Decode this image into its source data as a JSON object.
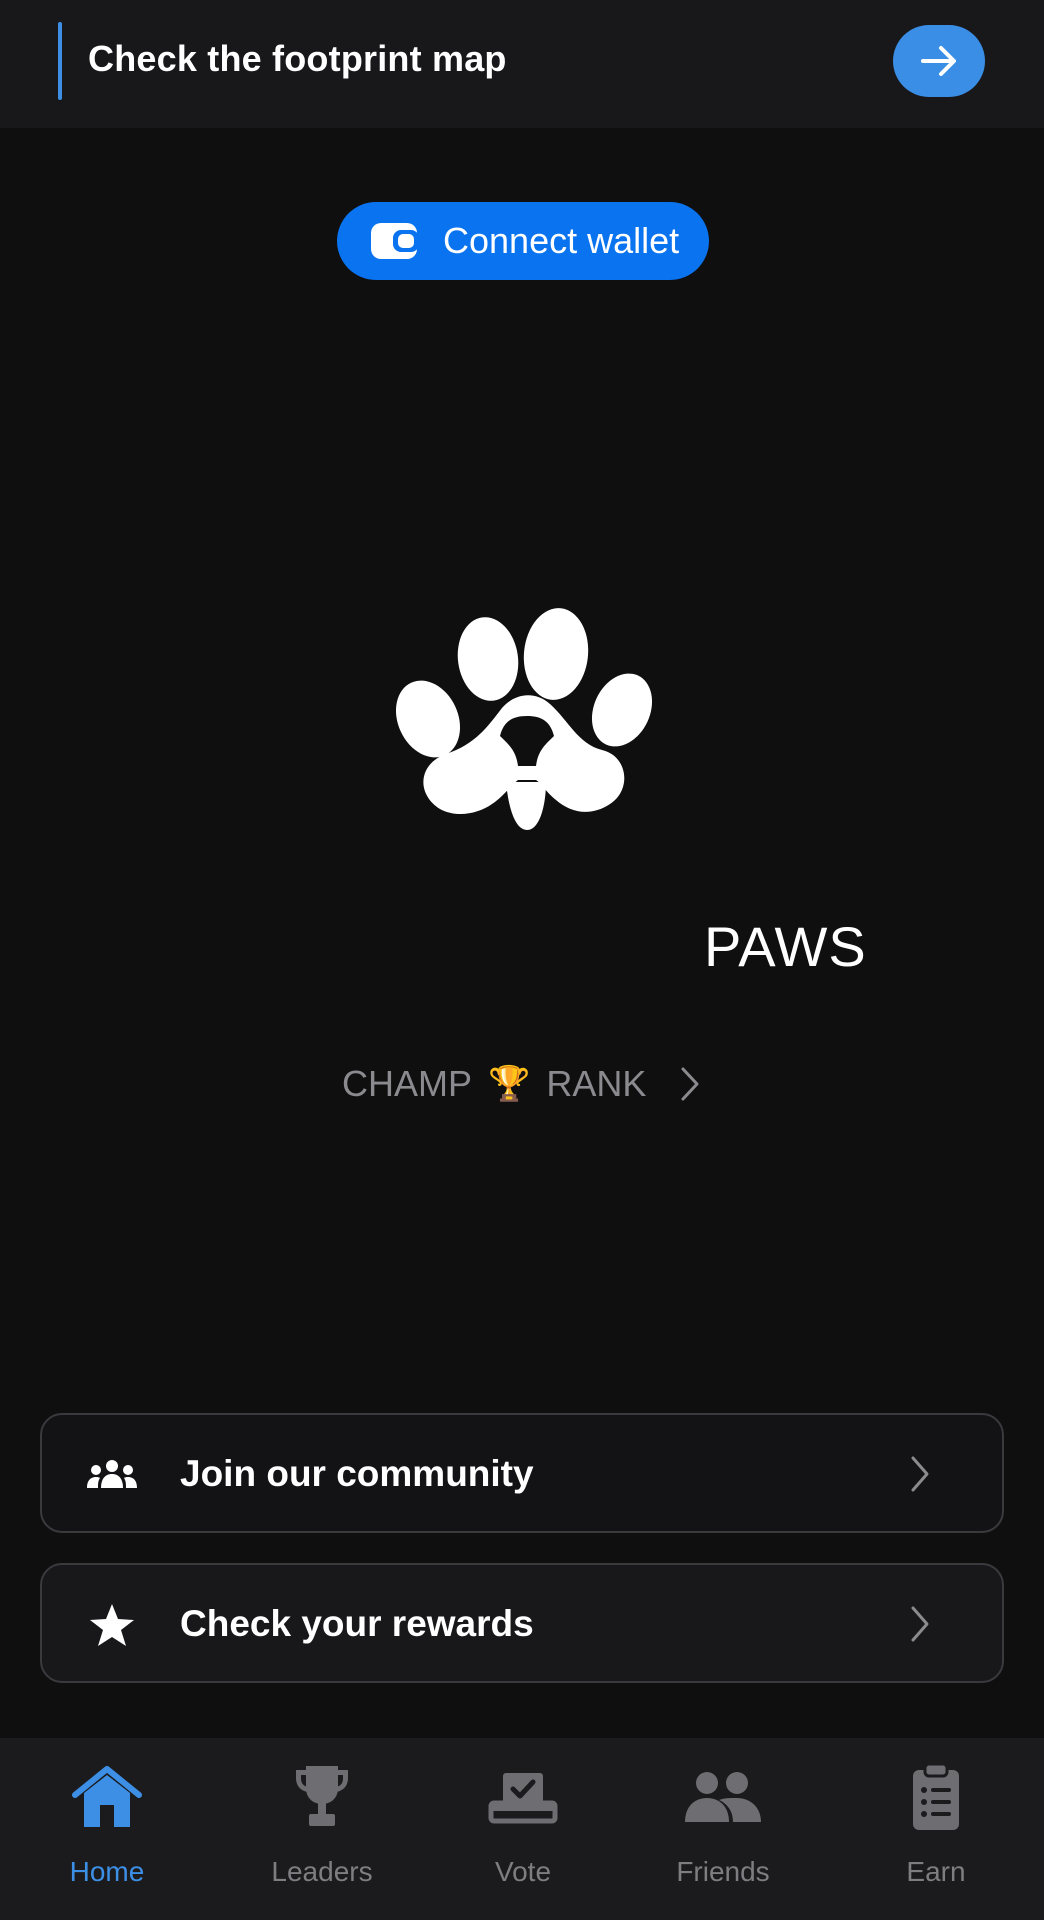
{
  "banner": {
    "text": "Check the footprint map",
    "action_icon": "arrow-right-icon"
  },
  "wallet": {
    "label": "Connect wallet",
    "icon": "wallet-icon"
  },
  "logo": {
    "icon": "paw-icon"
  },
  "balance": {
    "text": "PAWS"
  },
  "rank": {
    "left": "CHAMP",
    "trophy": "🏆",
    "right": "RANK"
  },
  "actions": [
    {
      "label": "Join our community",
      "icon": "people-icon"
    },
    {
      "label": "Check your rewards",
      "icon": "star-icon"
    }
  ],
  "nav": {
    "active": "Home",
    "items": [
      {
        "label": "Home",
        "icon": "home-icon"
      },
      {
        "label": "Leaders",
        "icon": "trophy-icon"
      },
      {
        "label": "Vote",
        "icon": "ballot-icon"
      },
      {
        "label": "Friends",
        "icon": "friends-icon"
      },
      {
        "label": "Earn",
        "icon": "clipboard-icon"
      }
    ]
  },
  "colors": {
    "background": "#0f0f10",
    "accent": "#3d8fe6",
    "wallet_button": "#0a73f0",
    "muted_text": "#8b8b8f",
    "nav_inactive": "#7d7d82"
  }
}
